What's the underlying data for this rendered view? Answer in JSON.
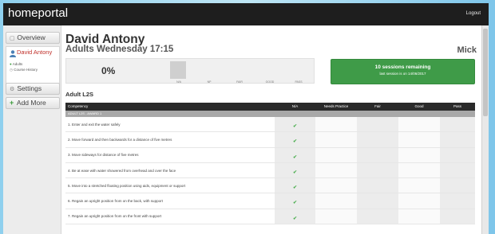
{
  "header": {
    "brand": "homeportal",
    "logout_label": "Logout"
  },
  "sidebar": {
    "overview_label": "Overview",
    "student_name": "David Antony",
    "links": [
      "Adults",
      "Course History"
    ],
    "settings_label": "Settings",
    "add_more_label": "Add More"
  },
  "main": {
    "student_name": "David Antony",
    "class_time": "Adults Wednesday 17:15",
    "teacher": "Mick",
    "progress_percent": "0%",
    "progress_bar_labels": [
      "N/A",
      "NP",
      "FAIR",
      "GOOD",
      "PASS"
    ],
    "sessions_remaining": "10 sessions remaining",
    "last_session": "last session is on 14/06/2017",
    "level_title": "Adult L2S"
  },
  "table": {
    "columns": [
      "Competency",
      "N/A",
      "Needs Practice",
      "Fair",
      "Good",
      "Pass"
    ],
    "group_label": "ADULT L2S - AWARD 1",
    "rows": [
      {
        "competency": "1. Enter and exit the water safely",
        "status": "N/A"
      },
      {
        "competency": "2. Move forward and then backwards for a distance of five metres",
        "status": "N/A"
      },
      {
        "competency": "3. Move sideways for distance of five metres",
        "status": "N/A"
      },
      {
        "competency": "4. Be at ease with water showered from overhead and over the face",
        "status": "N/A"
      },
      {
        "competency": "5. Move into a stretched floating position using aids, equipment or support",
        "status": "N/A"
      },
      {
        "competency": "6. Regain an upright position from on the back, with support",
        "status": "N/A"
      },
      {
        "competency": "7. Regain an upright position from on the front with support",
        "status": "N/A"
      }
    ],
    "tick_glyph": "✔"
  },
  "colors": {
    "topbar": "#1e1e1e",
    "accent_green": "#3f9b48",
    "student_red": "#c0302a"
  }
}
